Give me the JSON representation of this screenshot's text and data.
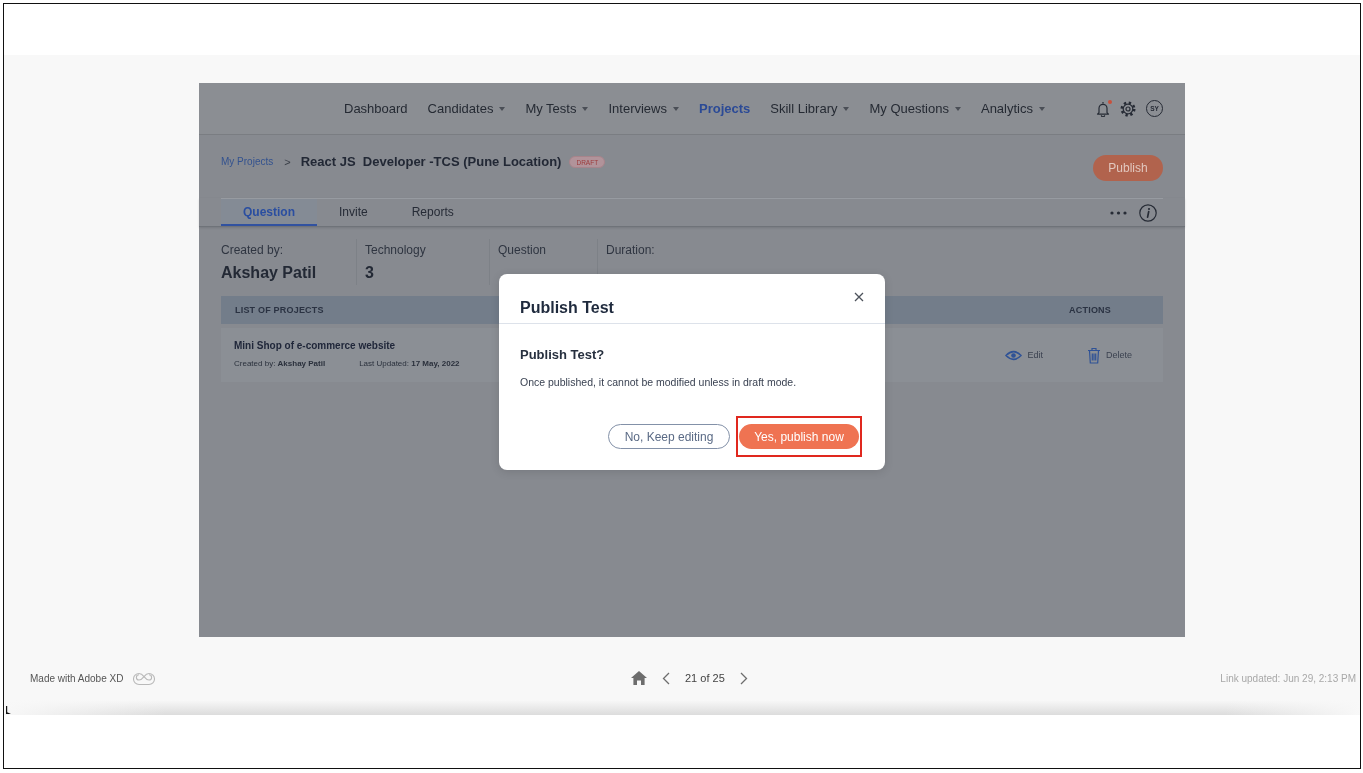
{
  "app": {
    "nav": {
      "items": [
        {
          "label": "Dashboard",
          "dropdown": false,
          "selected": false
        },
        {
          "label": "Candidates",
          "dropdown": true,
          "selected": false
        },
        {
          "label": "My Tests",
          "dropdown": true,
          "selected": false
        },
        {
          "label": "Interviews",
          "dropdown": true,
          "selected": false
        },
        {
          "label": "Projects",
          "dropdown": false,
          "selected": true
        },
        {
          "label": "Skill Library",
          "dropdown": true,
          "selected": false
        },
        {
          "label": "My Questions",
          "dropdown": true,
          "selected": false
        },
        {
          "label": "Analytics",
          "dropdown": true,
          "selected": false
        }
      ],
      "notification_dot": true,
      "avatar": "SY"
    },
    "breadcrumb": {
      "parent": "My Projects",
      "separator": ">",
      "title": "React JS  Developer -TCS (Pune Location)",
      "badge": "DRAFT"
    },
    "publish_button": "Publish",
    "tabs": [
      {
        "label": "Question",
        "selected": true
      },
      {
        "label": "Invite",
        "selected": false
      },
      {
        "label": "Reports",
        "selected": false
      }
    ],
    "stats": [
      {
        "label": "Created by:",
        "value": "Akshay Patil"
      },
      {
        "label": "Technology",
        "value": "3"
      },
      {
        "label": "Question"
      },
      {
        "label": "Duration:"
      }
    ],
    "table": {
      "columns": [
        "LIST OF PROJECTS",
        "ACTIONS"
      ],
      "rows": [
        {
          "title": "Mini Shop of e-commerce website",
          "created_by": "Created by: **Akshay Patil**",
          "last_updated": "Last Updated: **17 May, 2022**",
          "actions": [
            {
              "label": "Edit",
              "kind": "view"
            },
            {
              "label": "Delete",
              "kind": "delete"
            }
          ]
        }
      ]
    }
  },
  "dialog": {
    "title": "Publish Test",
    "heading": "Publish Test?",
    "message": "Once published, it cannot be modified unless in draft mode.",
    "buttons": [
      {
        "label": "No, Keep editing",
        "kind": "secondary",
        "highlighted": false
      },
      {
        "label": "Yes, publish now",
        "kind": "primary",
        "highlighted": true
      }
    ]
  },
  "footer": {
    "made_with": "Made with Adobe XD",
    "page": "21 of 25",
    "link_updated": "Link updated: Jun 29, 2:13 PM"
  }
}
